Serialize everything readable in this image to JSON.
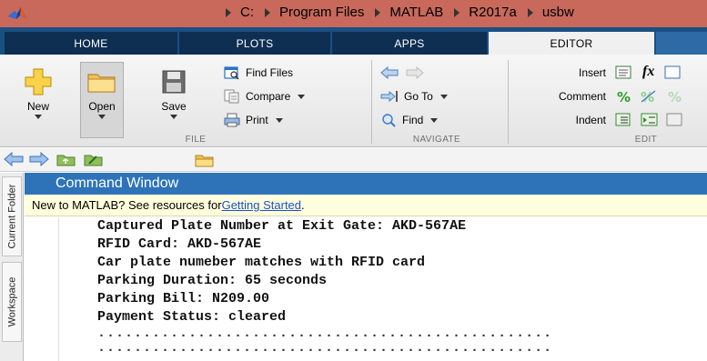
{
  "tabs": [
    {
      "label": "HOME"
    },
    {
      "label": "PLOTS"
    },
    {
      "label": "APPS"
    },
    {
      "label": "EDITOR"
    }
  ],
  "ribbon": {
    "file": {
      "new_label": "New",
      "open_label": "Open",
      "save_label": "Save",
      "find_files_label": "Find Files",
      "compare_label": "Compare",
      "print_label": "Print",
      "group_label": "FILE"
    },
    "navigate": {
      "goto_label": "Go To",
      "find_label": "Find",
      "group_label": "NAVIGATE"
    },
    "edit": {
      "insert_label": "Insert",
      "comment_label": "Comment",
      "indent_label": "Indent",
      "fx_label": "fx",
      "group_label": "EDIT"
    }
  },
  "address": {
    "crumbs": [
      "C:",
      "Program Files",
      "MATLAB",
      "R2017a",
      "usbw"
    ]
  },
  "side_tabs": {
    "current_folder": "Current Folder",
    "workspace": "Workspace"
  },
  "command_window": {
    "title": "Command Window",
    "notice_prefix": "New to MATLAB? See resources for ",
    "notice_link": "Getting Started",
    "notice_suffix": ".",
    "lines": [
      "Captured Plate Number at Exit Gate: AKD-567AE",
      "RFID Card: AKD-567AE",
      "Car plate numeber matches with RFID card",
      "Parking Duration: 65 seconds",
      "Parking Bill: N209.00",
      "Payment Status: cleared"
    ],
    "dots_line_1": "..................................................",
    "dots_line_2": ".................................................."
  },
  "colors": {
    "titlebar": "#c8695c",
    "tabstrip": "#1a4f82",
    "command_title": "#2e73b8",
    "notice_bg": "#ffffdd"
  }
}
